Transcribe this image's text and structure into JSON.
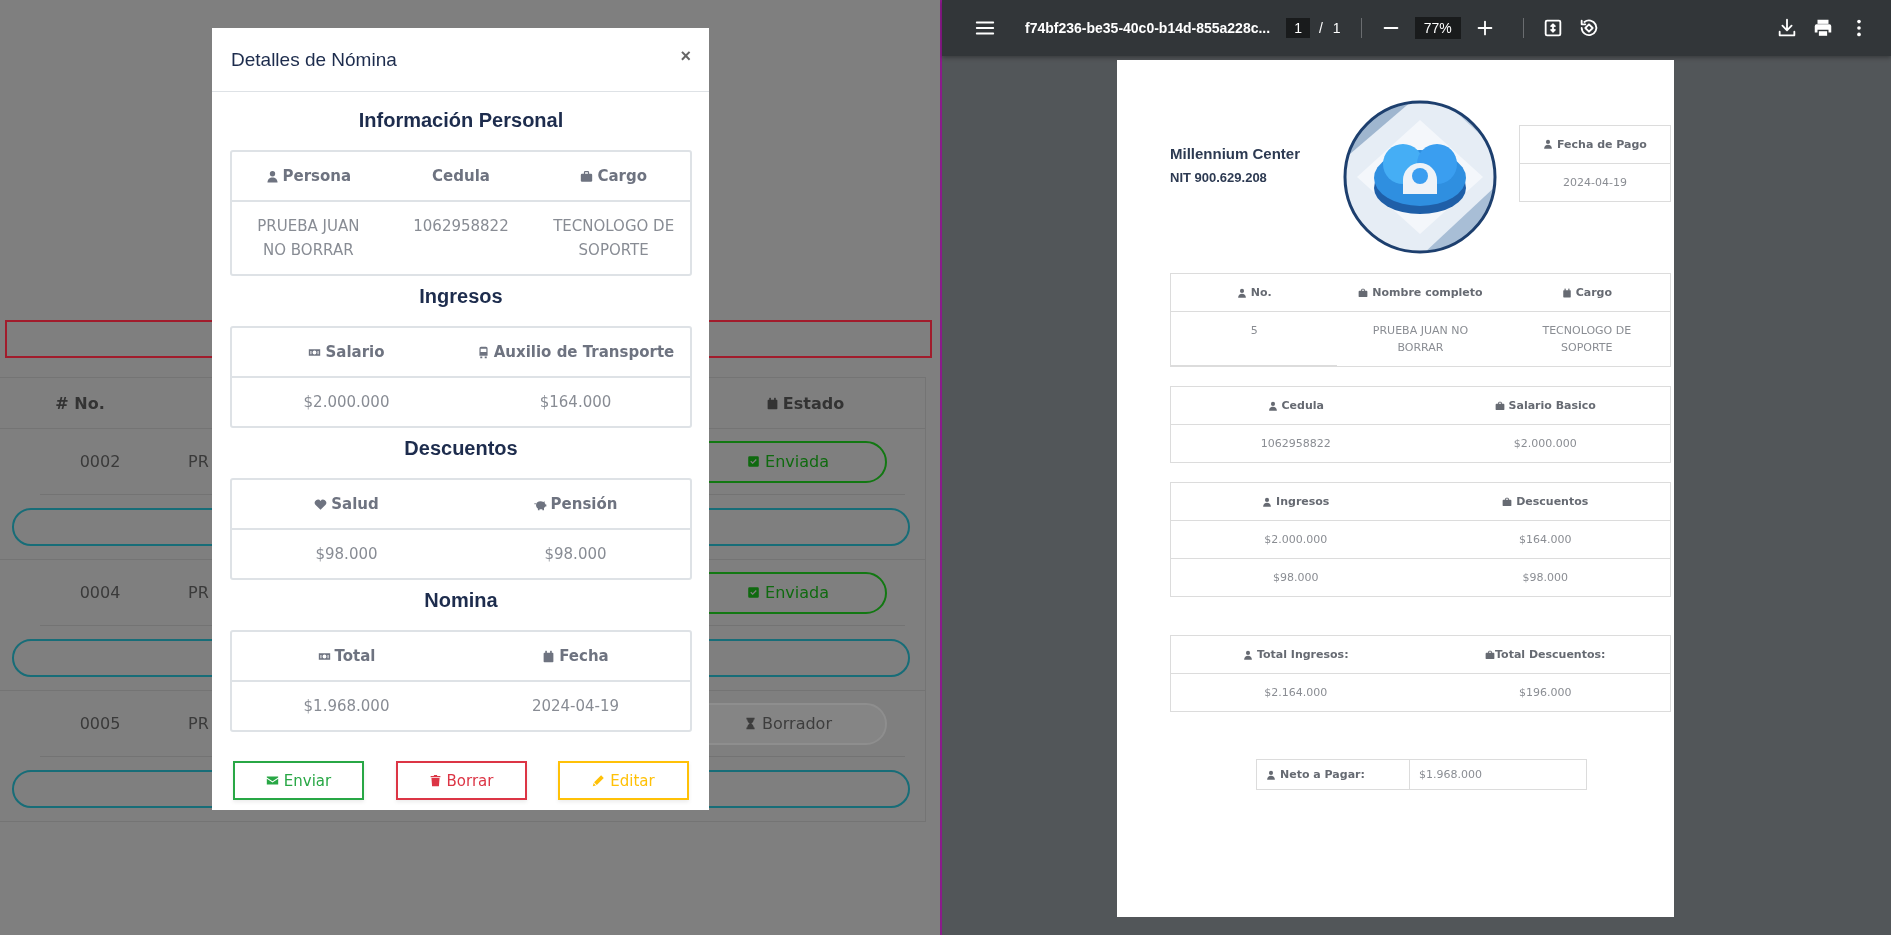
{
  "background": {
    "table": {
      "columns": [
        "# No.",
        "Estado"
      ],
      "rows": [
        {
          "number": "0002",
          "name": "PR",
          "status": {
            "kind": "sent",
            "label": "Enviada"
          }
        },
        {
          "number": "0004",
          "name": "PR",
          "status": {
            "kind": "sent",
            "label": "Enviada"
          }
        },
        {
          "number": "0005",
          "name": "PR",
          "status": {
            "kind": "draft",
            "label": "Borrador"
          }
        }
      ]
    }
  },
  "modal": {
    "title": "Detalles de Nómina",
    "close": "×",
    "sections": [
      {
        "title": "Información Personal",
        "columns": [
          "Persona",
          "Cedula",
          "Cargo"
        ],
        "rows": [
          [
            "PRUEBA JUAN NO BORRAR",
            "1062958822",
            "TECNOLOGO DE SOPORTE"
          ]
        ]
      },
      {
        "title": "Ingresos",
        "columns": [
          "Salario",
          "Auxilio de Transporte"
        ],
        "rows": [
          [
            "$2.000.000",
            "$164.000"
          ]
        ]
      },
      {
        "title": "Descuentos",
        "columns": [
          "Salud",
          "Pensión"
        ],
        "rows": [
          [
            "$98.000",
            "$98.000"
          ]
        ]
      },
      {
        "title": "Nomina",
        "columns": [
          "Total",
          "Fecha"
        ],
        "rows": [
          [
            "$1.968.000",
            "2024-04-19"
          ]
        ]
      }
    ],
    "buttons": [
      {
        "label": "Enviar",
        "kind": "send"
      },
      {
        "label": "Borrar",
        "kind": "delete"
      },
      {
        "label": "Editar",
        "kind": "edit"
      }
    ]
  },
  "pdf_viewer": {
    "file_name": "f74bf236-be35-40c0-b14d-855a228c...",
    "page": "1",
    "page_separator": "/",
    "page_count": "1",
    "zoom": "77%",
    "document": {
      "company": {
        "name": "Millennium Center",
        "nit": "NIT 900.629.208"
      },
      "pay_date": {
        "label": "Fecha de Pago",
        "value": "2024-04-19"
      },
      "tables": [
        {
          "columns": [
            "No.",
            "Nombre completo",
            "Cargo"
          ],
          "rows": [
            [
              "5",
              "PRUEBA JUAN NO BORRAR",
              "TECNOLOGO DE SOPORTE"
            ]
          ]
        },
        {
          "columns": [
            "Cedula",
            "Salario Basico"
          ],
          "rows": [
            [
              "1062958822",
              "$2.000.000"
            ]
          ]
        },
        {
          "columns": [
            "Ingresos",
            "Descuentos"
          ],
          "rows": [
            [
              "$2.000.000",
              "$164.000"
            ],
            [
              "$98.000",
              "$98.000"
            ]
          ]
        },
        {
          "columns": [
            "Total Ingresos:",
            "Total Descuentos:"
          ],
          "rows": [
            [
              "$2.164.000",
              "$196.000"
            ]
          ]
        }
      ],
      "net": {
        "label": "Neto a Pagar:",
        "value": "$1.968.000"
      }
    }
  }
}
